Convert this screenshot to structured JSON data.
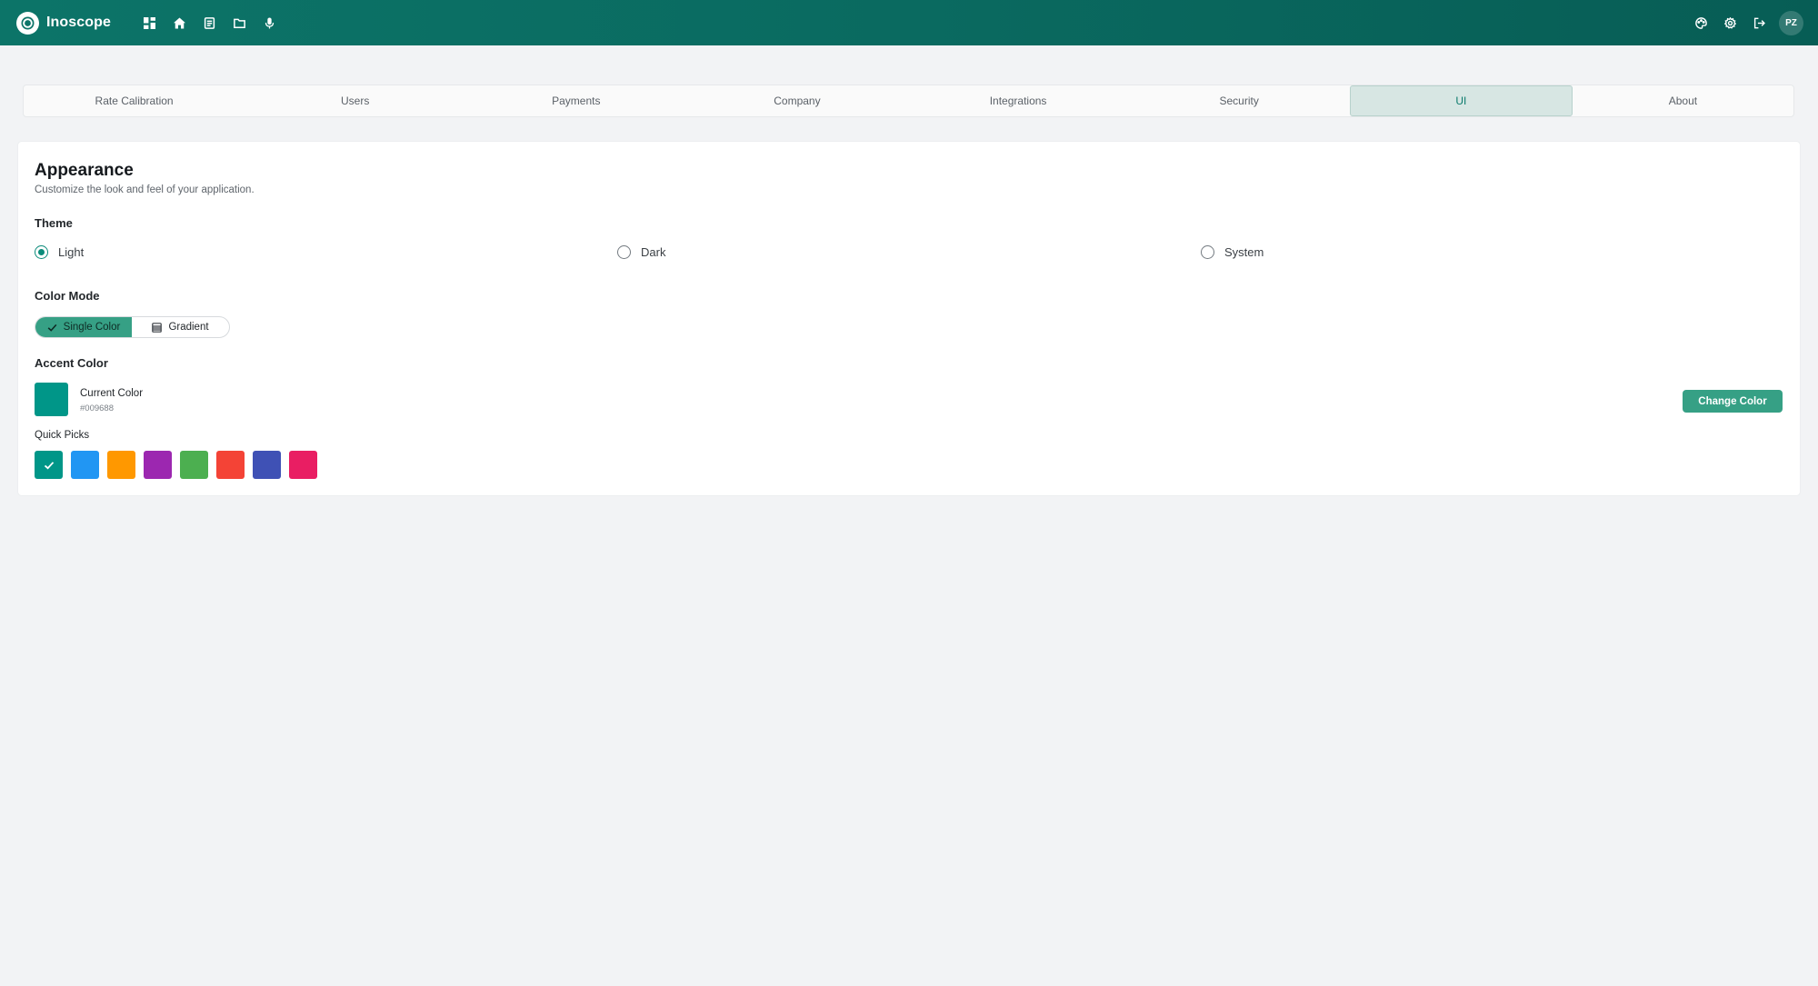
{
  "app": {
    "name": "Inoscope",
    "user_initials": "PZ"
  },
  "nav": {
    "left_icons": [
      "dashboard-icon",
      "home-icon",
      "document-icon",
      "folder-icon",
      "microphone-icon"
    ],
    "right_icons": [
      "palette-icon",
      "gear-icon",
      "logout-icon"
    ]
  },
  "tabs": [
    {
      "label": "Rate Calibration",
      "active": false
    },
    {
      "label": "Users",
      "active": false
    },
    {
      "label": "Payments",
      "active": false
    },
    {
      "label": "Company",
      "active": false
    },
    {
      "label": "Integrations",
      "active": false
    },
    {
      "label": "Security",
      "active": false
    },
    {
      "label": "UI",
      "active": true
    },
    {
      "label": "About",
      "active": false
    }
  ],
  "appearance": {
    "title": "Appearance",
    "subtitle": "Customize the look and feel of your application.",
    "theme": {
      "label": "Theme",
      "options": [
        {
          "label": "Light",
          "checked": true
        },
        {
          "label": "Dark",
          "checked": false
        },
        {
          "label": "System",
          "checked": false
        }
      ]
    },
    "color_mode": {
      "label": "Color Mode",
      "single_label": "Single Color",
      "gradient_label": "Gradient",
      "selected": "Single Color"
    },
    "accent": {
      "label": "Accent Color",
      "current_label": "Current Color",
      "current_hex": "#009688",
      "change_button": "Change Color",
      "quick_picks_label": "Quick Picks",
      "quick_picks": [
        "#009688",
        "#2196F3",
        "#FF9800",
        "#9C27B0",
        "#4CAF50",
        "#F44336",
        "#3F51B5",
        "#E91E63"
      ],
      "selected_index": 0
    }
  },
  "colors": {
    "header": "#0a6a60",
    "accent_button": "#36a085",
    "active_tab_bg": "#d7e6e3",
    "active_tab_text": "#0b7a6c"
  }
}
